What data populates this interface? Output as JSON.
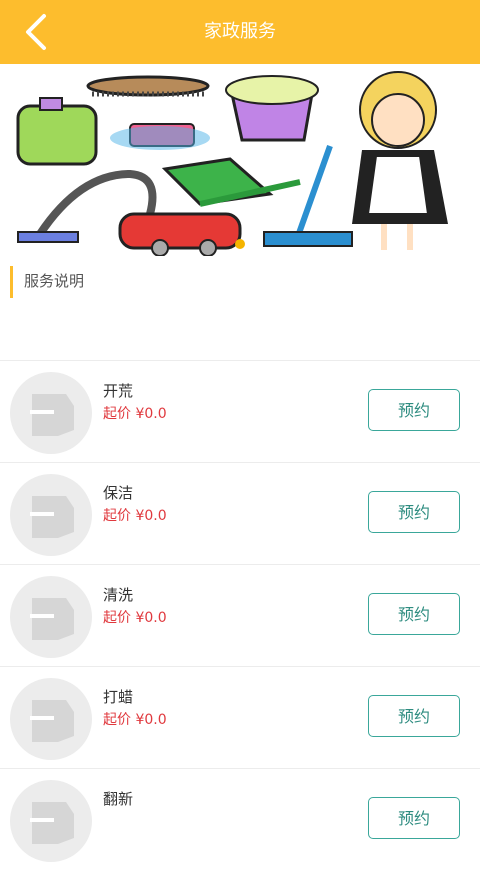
{
  "header": {
    "title": "家政服务",
    "accent": "#fdbd2d"
  },
  "section": {
    "label": "服务说明"
  },
  "services": [
    {
      "name": "开荒",
      "price": "起价 ¥0.0",
      "action": "预约"
    },
    {
      "name": "保洁",
      "price": "起价 ¥0.0",
      "action": "预约"
    },
    {
      "name": "清洗",
      "price": "起价 ¥0.0",
      "action": "预约"
    },
    {
      "name": "打蜡",
      "price": "起价 ¥0.0",
      "action": "预约"
    },
    {
      "name": "翻新",
      "price": "",
      "action": "预约"
    }
  ],
  "colors": {
    "price": "#e0393e",
    "button_border": "#3aa79a"
  }
}
